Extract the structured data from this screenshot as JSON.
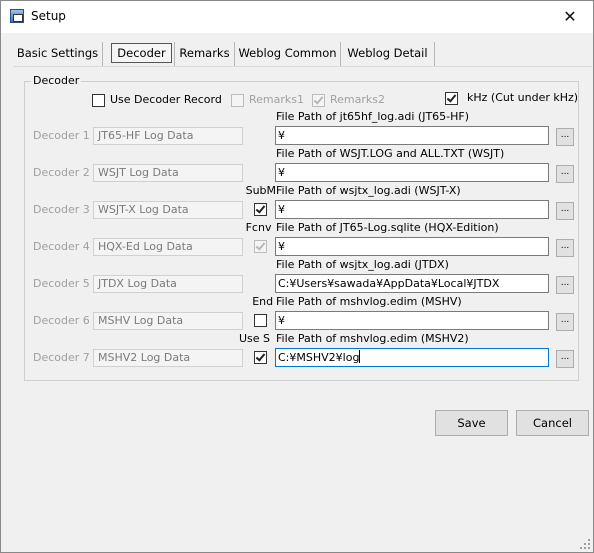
{
  "window": {
    "title": "Setup",
    "close_glyph": "✕"
  },
  "tabs": [
    {
      "label": "Basic Settings"
    },
    {
      "label": "Decoder"
    },
    {
      "label": "Remarks"
    },
    {
      "label": "Weblog Common"
    },
    {
      "label": "Weblog Detail"
    }
  ],
  "active_tab": "Decoder",
  "group": {
    "label": "Decoder",
    "use_record_label": "Use Decoder Record",
    "use_record_checked": false,
    "remarks1_label": "Remarks1",
    "remarks1_checked": false,
    "remarks2_label": "Remarks2",
    "remarks2_checked": true,
    "khz_label": "kHz (Cut under kHz)",
    "khz_checked": true
  },
  "decoders": [
    {
      "num_label": "Decoder 1",
      "name": "JT65-HF Log Data",
      "option_label": "",
      "option_checked": null,
      "path_label": "File Path of jt65hf_log.adi (JT65-HF)",
      "path": "¥",
      "browse": "..."
    },
    {
      "num_label": "Decoder 2",
      "name": "WSJT Log Data",
      "option_label": "",
      "option_checked": null,
      "path_label": "File Path of WSJT.LOG and ALL.TXT (WSJT)",
      "path": "¥",
      "browse": "..."
    },
    {
      "num_label": "Decoder 3",
      "name": "WSJT-X Log Data",
      "option_label": "SubM",
      "option_checked": true,
      "path_label": "File Path of wsjtx_log.adi (WSJT-X)",
      "path": "¥",
      "browse": "..."
    },
    {
      "num_label": "Decoder 4",
      "name": "HQX-Ed Log Data",
      "option_label": "Fcnv",
      "option_checked": true,
      "option_disabled": true,
      "path_label": "File Path of JT65-Log.sqlite (HQX-Edition)",
      "path": "¥",
      "browse": "..."
    },
    {
      "num_label": "Decoder 5",
      "name": "JTDX Log Data",
      "option_label": "",
      "option_checked": null,
      "path_label": "File Path of wsjtx_log.adi (JTDX)",
      "path": "C:¥Users¥sawada¥AppData¥Local¥JTDX",
      "browse": "..."
    },
    {
      "num_label": "Decoder 6",
      "name": "MSHV Log Data",
      "option_label": "End",
      "option_checked": false,
      "path_label": "File Path of mshvlog.edim (MSHV)",
      "path": "¥",
      "browse": "..."
    },
    {
      "num_label": "Decoder 7",
      "name": "MSHV2 Log Data",
      "option_label": "Use S",
      "option_checked": true,
      "path_label": "File Path of mshvlog.edim (MSHV2)",
      "path": "C:¥MSHV2¥log",
      "browse": "...",
      "focused": true
    }
  ],
  "buttons": {
    "save": "Save",
    "cancel": "Cancel"
  }
}
